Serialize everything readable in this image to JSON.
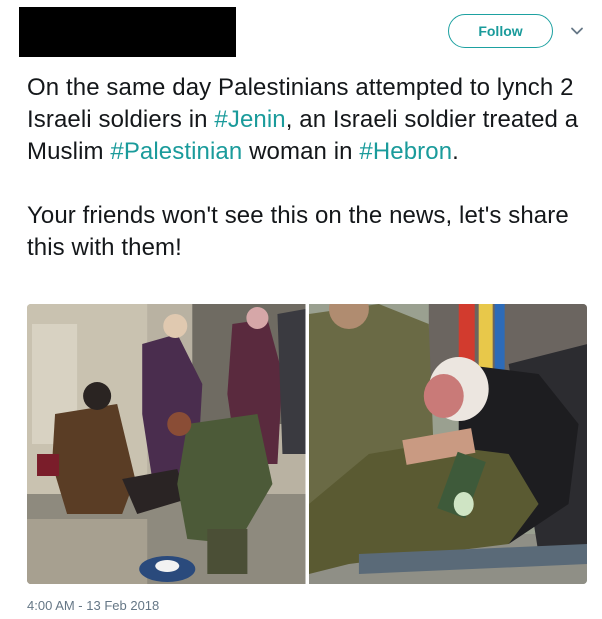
{
  "header": {
    "follow_label": "Follow",
    "menu_icon": "chevron-down-icon"
  },
  "tweet": {
    "p1": {
      "t1": "On the same day Palestinians attempted to lynch 2 Israeli soldiers in ",
      "h1": "#Jenin",
      "t2": ", an Israeli soldier treated a Muslim ",
      "h2": "#Palestinian",
      "t3": " woman in ",
      "h3": "#Hebron",
      "t4": "."
    },
    "p2": "Your friends won't see this on the news, let's share this with them!"
  },
  "media": {
    "count": 2,
    "photos": [
      {
        "kind": "photo"
      },
      {
        "kind": "photo"
      }
    ]
  },
  "timestamp": "4:00 AM - 13 Feb 2018",
  "colors": {
    "accent": "#1a9b9b",
    "text": "#14171a",
    "muted": "#657786",
    "redaction": "#000000"
  }
}
